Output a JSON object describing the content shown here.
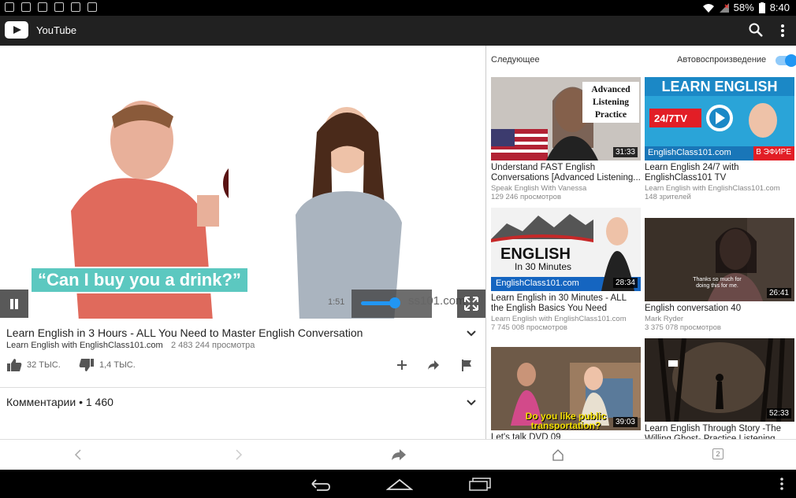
{
  "statusbar": {
    "battery": "58%",
    "time": "8:40"
  },
  "app": {
    "title": "YouTube"
  },
  "player": {
    "caption": "“Can I buy you a drink?”",
    "time": "1:51",
    "watermark": "ss101.com"
  },
  "video": {
    "title": "Learn English in 3 Hours - ALL You Need to Master English Conversation",
    "channel": "Learn English with EnglishClass101.com",
    "views": "2 483 244 просмотра",
    "likes": "32 ТЫС.",
    "dislikes": "1,4 ТЫС."
  },
  "comments": {
    "label": "Комментарии • 1 460"
  },
  "sidebar": {
    "next_label": "Следующее",
    "autoplay_label": "Автовоспроизведение",
    "cards": [
      {
        "title": "Understand FAST English Conversations [Advanced Listening...",
        "channel": "Speak English With Vanessa",
        "meta": "129 246 просмотров",
        "duration": "31:33",
        "thumb_text": "Advanced Listening Practice"
      },
      {
        "title": "Learn English 24/7 with EnglishClass101 TV",
        "channel": "Learn English with EnglishClass101.com",
        "meta": "148 зрителей",
        "duration": "В ЭФИРЕ",
        "thumb_text": "LEARN ENGLISH",
        "thumb_sub": "EnglishClass101.com",
        "thumb_badge": "24/7TV"
      },
      {
        "title": "Learn English in 30 Minutes - ALL the English Basics You Need",
        "channel": "Learn English with EnglishClass101.com",
        "meta": "7 745 008 просмотров",
        "duration": "28:34",
        "thumb_text": "ENGLISH",
        "thumb_sub2": "In 30 Minutes",
        "thumb_sub": "EnglishClass101.com"
      },
      {
        "title": "English conversation 40",
        "channel": "Mark Ryder",
        "meta": "3 375 078 просмотров",
        "duration": "26:41",
        "thumb_text": "Thanks so much for doing this for me."
      },
      {
        "title": "Let's talk DVD 09",
        "duration": "39:03",
        "thumb_text": "Do you like public transportation?"
      },
      {
        "title": "Learn English Through Story -The Willing Ghost- Practice Listening",
        "duration": "52:33"
      }
    ]
  },
  "bottom": {
    "tabs_count": "2"
  }
}
